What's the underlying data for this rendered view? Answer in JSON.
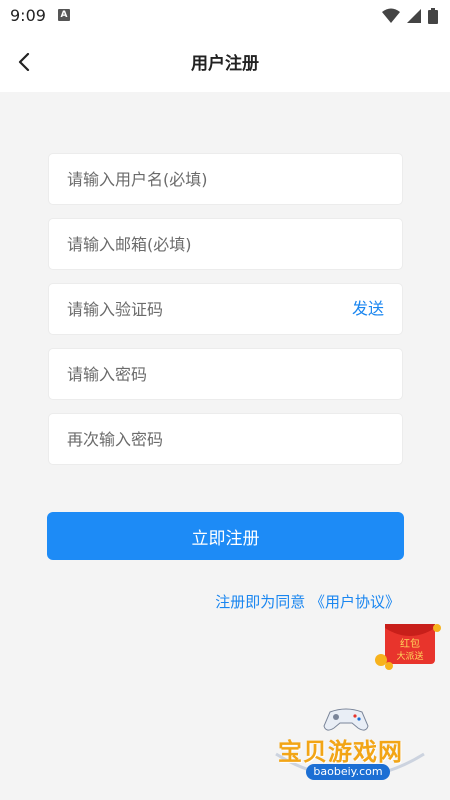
{
  "status_bar": {
    "time": "9:09",
    "a_badge": "A"
  },
  "header": {
    "title": "用户注册",
    "back_icon": "chevron-left-icon"
  },
  "form": {
    "username_placeholder": "请输入用户名(必填)",
    "email_placeholder": "请输入邮箱(必填)",
    "code_placeholder": "请输入验证码",
    "send_label": "发送",
    "password_placeholder": "请输入密码",
    "confirm_password_placeholder": "再次输入密码",
    "submit_label": "立即注册"
  },
  "agreement": {
    "prefix": "注册即为同意 ",
    "link": "《用户协议》"
  },
  "promo": {
    "text_line1": "红包",
    "text_line2": "大派送"
  },
  "watermark": {
    "text": "宝贝游戏网",
    "domain": "baobeiy.com"
  },
  "colors": {
    "accent": "#1d8bf6",
    "link": "#1a86f0",
    "background": "#f4f4f4"
  }
}
